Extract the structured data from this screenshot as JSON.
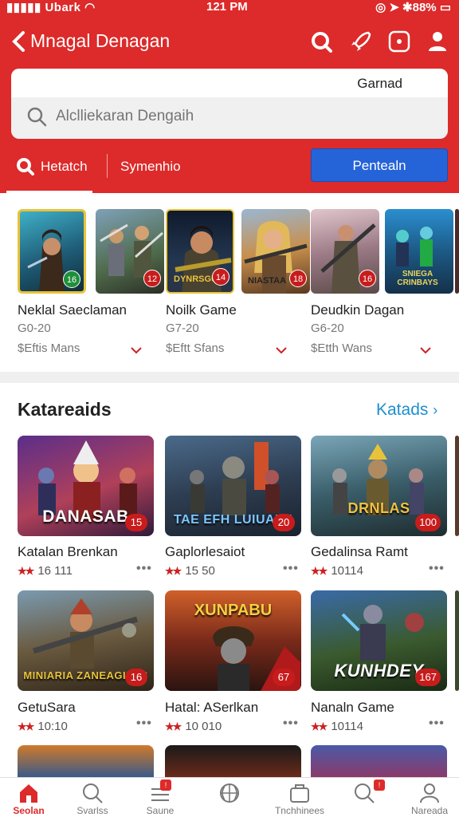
{
  "status_bar": {
    "left": "Ubark",
    "time": "121 PM",
    "battery": "88%"
  },
  "header": {
    "title": "Mnagal Denagan",
    "tag": "Garnad"
  },
  "search": {
    "placeholder": "Alclliekaran Dengaih"
  },
  "tabs": {
    "tab1": "Hetatch",
    "tab2": "Symenhio",
    "button": "Pentealn"
  },
  "featured": [
    {
      "name": "Neklal Saeclaman",
      "range": "G0-20",
      "price": "$Eftis Mans",
      "badge": "16",
      "art": ""
    },
    {
      "name": "",
      "range": "",
      "price": "",
      "badge": "12",
      "art": ""
    },
    {
      "name": "Noilk Game",
      "range": "G7-20",
      "price": "$Eftt Sfans",
      "badge": "14",
      "art": "DYNRSGUI"
    },
    {
      "name": "",
      "range": "",
      "price": "",
      "badge": "18",
      "art": "NIASTAA"
    },
    {
      "name": "Deudkin Dagan",
      "range": "G6-20",
      "price": "$Etth Wans",
      "badge": "16",
      "art": ""
    },
    {
      "name": "",
      "range": "",
      "price": "",
      "badge": "",
      "art": "SNIEGA CRINBAYS"
    }
  ],
  "section": {
    "title": "Katareaids",
    "link": "Katads"
  },
  "cards": [
    {
      "name": "Katalan Brenkan",
      "rating": "16 111",
      "badge": "15",
      "art": "DANASAB"
    },
    {
      "name": "Gaplorlesaiot",
      "rating": "15 50",
      "badge": "20",
      "art": "TAE EFH LUIUAIAI"
    },
    {
      "name": "Gedalinsa Ramt",
      "rating": "10114",
      "badge": "100",
      "art": "DRNLAS"
    },
    {
      "name": "GetuSara",
      "rating": "10:10",
      "badge": "16",
      "art": "MINIARIA ZANEAGIEES"
    },
    {
      "name": "Hatal: ASerlkan",
      "rating": "10 010",
      "badge": "67",
      "art": "XUNPABU"
    },
    {
      "name": "Nanaln Game",
      "rating": "10114",
      "badge": "167",
      "art": "KUNHDEY"
    }
  ],
  "bottom_nav": [
    {
      "label": "Seolan",
      "icon": "home-icon"
    },
    {
      "label": "Svarlss",
      "icon": "search-icon"
    },
    {
      "label": "Saune",
      "icon": "list-icon"
    },
    {
      "label": "",
      "icon": "globe-icon"
    },
    {
      "label": "Tnchhinees",
      "icon": "collection-icon"
    },
    {
      "label": "",
      "icon": "search-badge-icon"
    },
    {
      "label": "Nareada",
      "icon": "profile-icon"
    }
  ],
  "colors": {
    "brand": "#dd2a2a",
    "accent": "#2563d8",
    "link": "#1d8fd0"
  }
}
